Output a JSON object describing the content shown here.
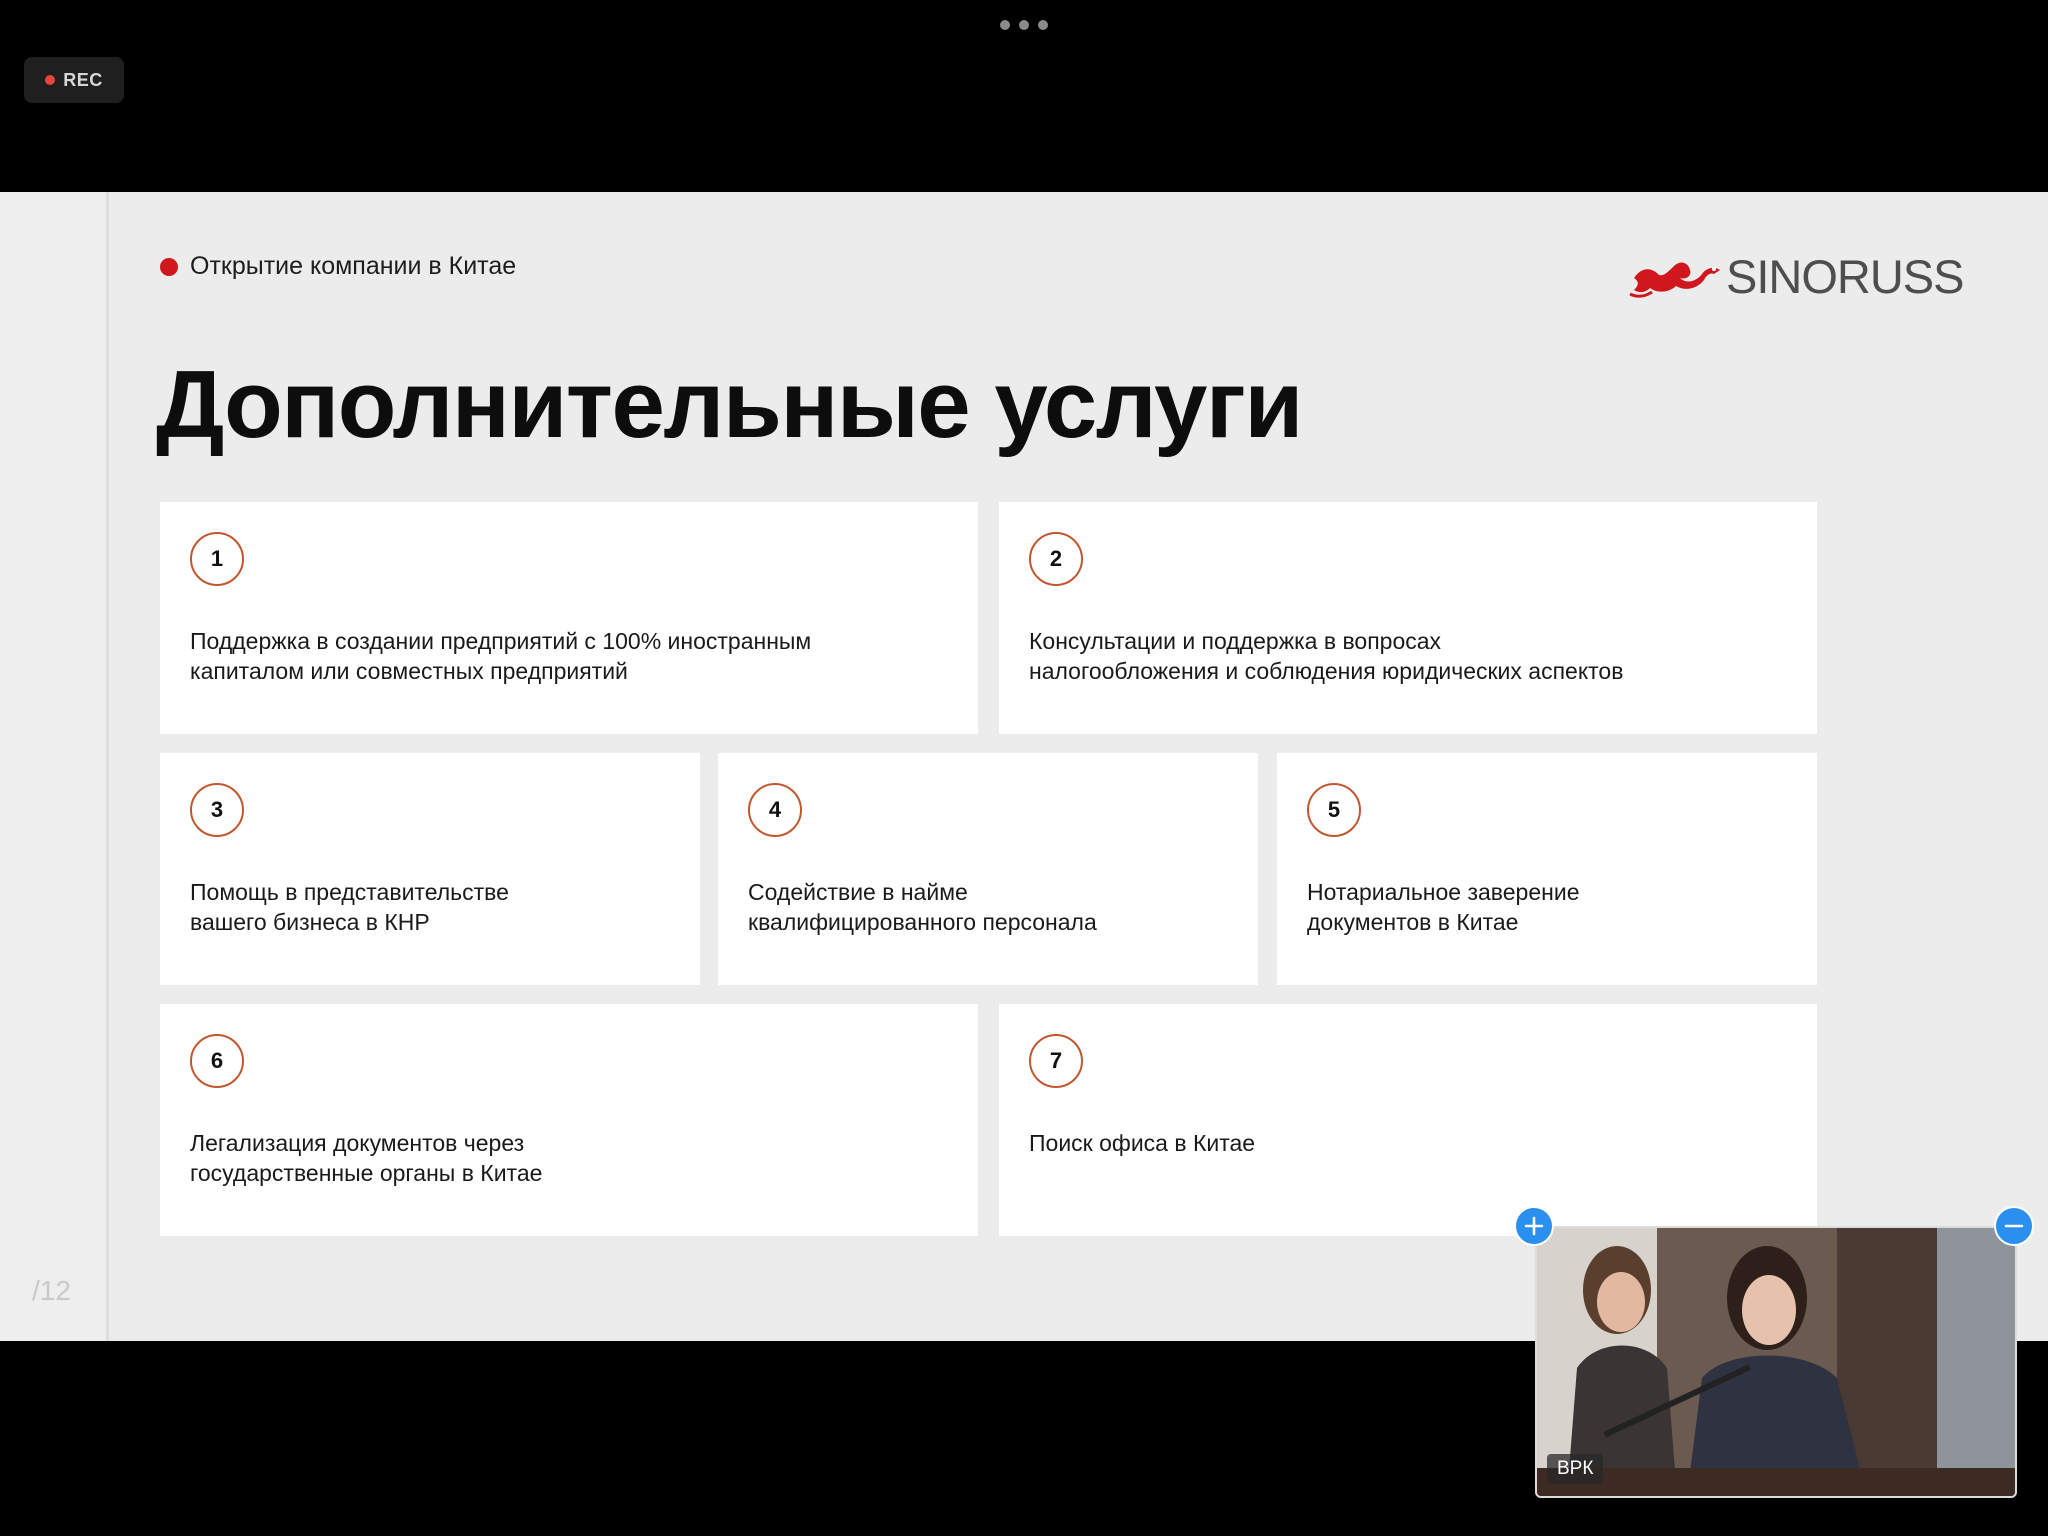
{
  "recording": {
    "label": "REC"
  },
  "slide": {
    "kicker": "Открытие компании в Китае",
    "logo_text": "SINORUSS",
    "title": "Дополнительные услуги",
    "page_indicator": "/12",
    "services": [
      {
        "number": "1",
        "text": "Поддержка в создании предприятий с 100% иностранным\nкапиталом или совместных предприятий"
      },
      {
        "number": "2",
        "text": "Консультации и поддержка в вопросах\nналогообложения и соблюдения юридических аспектов"
      },
      {
        "number": "3",
        "text": "Помощь в представительстве\nвашего бизнеса в КНР"
      },
      {
        "number": "4",
        "text": "Содействие в найме\nквалифицированного персонала"
      },
      {
        "number": "5",
        "text": "Нотариальное заверение\nдокументов в Китае"
      },
      {
        "number": "6",
        "text": "Легализация документов через\nгосударственные органы в Китае"
      },
      {
        "number": "7",
        "text": "Поиск офиса в Китае"
      }
    ]
  },
  "video": {
    "participant_name": "ВРК"
  },
  "colors": {
    "accent": "#d0171d",
    "circle_border": "#c2562e",
    "control_blue": "#2b8ff0",
    "slide_bg": "#ececec"
  },
  "icons": {
    "more": "more-dots-icon",
    "zoom_in": "plus-icon",
    "zoom_out": "minus-icon",
    "logo": "dragon-icon"
  }
}
